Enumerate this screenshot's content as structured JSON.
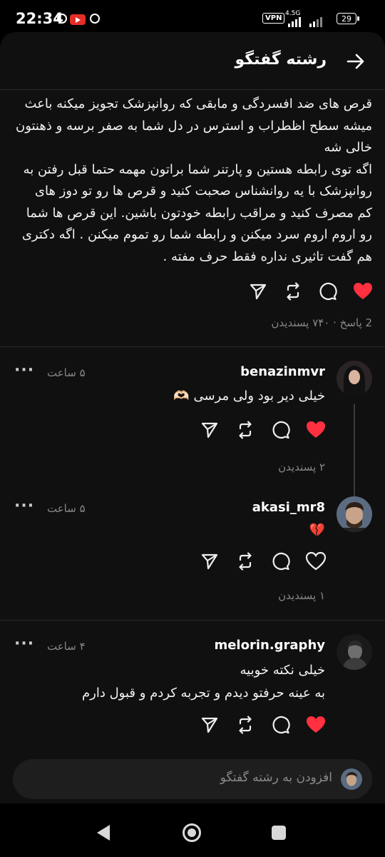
{
  "status_bar": {
    "time": "22:34",
    "vpn": "VPN",
    "network": "4.5G",
    "battery": "29"
  },
  "header": {
    "title": "رشته گفتگو"
  },
  "post": {
    "lines": [
      "قرص  های ضد افسردگی و مابقی که روانپزشک تجویز میکنه باعث",
      "میشه سطح اظطراب و استرس در دل شما به صفر برسه و ذهنتون",
      "خالی شه",
      "اگه توی رابطه هستین و پارتنر شما براتون مهمه حتما قبل رفتن به",
      "روانپزشک با یه روانشناس صحبت کنید و قرص ها رو تو دوز های",
      "کم مصرف کنید و مراقب رابطه خودتون باشین. این قرص ها شما",
      "رو اروم اروم سرد میکنن و رابطه شما رو تموم میکنن . اگه دکتری",
      "هم گفت تاثیری نداره فقط حرف مفته ."
    ],
    "liked": true,
    "meta": "2 پاسخ · ۷۴۰ پسندیدن"
  },
  "replies": [
    {
      "username": "benazinmvr",
      "time": "۵ ساعت",
      "text": [
        "خیلی دیر بود ولی مرسی 🫶🏻"
      ],
      "liked": true,
      "likes": "۲ پسندیدن"
    },
    {
      "username": "akasi_mr8",
      "time": "۵ ساعت",
      "text": [
        "💔"
      ],
      "liked": false,
      "likes": "۱ پسندیدن"
    },
    {
      "username": "melorin.graphy",
      "time": "۴ ساعت",
      "text": [
        "خیلی نکته خوبیه",
        "به عینه حرفتو دیدم و تجربه کردم و قبول دارم"
      ],
      "liked": true
    }
  ],
  "compose": {
    "placeholder": "افزودن به رشته گفتگو"
  },
  "icons": {
    "back": "arrow-right-icon",
    "like": "heart-icon",
    "comment": "comment-icon",
    "repost": "repost-icon",
    "share": "send-icon",
    "more": "more-icon"
  },
  "colors": {
    "like_red": "#ff3040",
    "background": "#101010"
  }
}
